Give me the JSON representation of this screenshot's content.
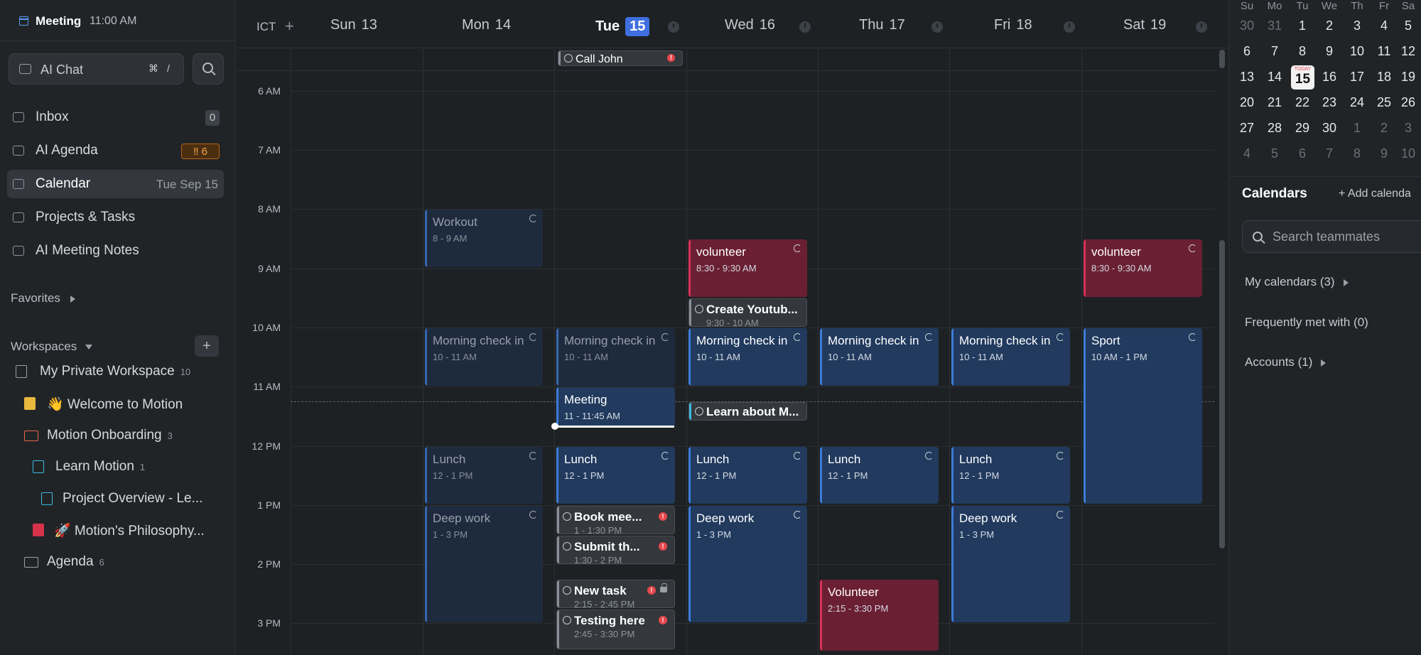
{
  "topbar": {
    "title": "Meeting",
    "time": "11:00 AM",
    "icon": "calendar-icon"
  },
  "search": {
    "ai_chat_label": "AI Chat",
    "shortcut_key": "⌘",
    "shortcut_slash": "/"
  },
  "nav": [
    {
      "label": "Inbox",
      "badge": "0",
      "icon": "inbox-icon"
    },
    {
      "label": "AI Agenda",
      "badge": "‼ 6",
      "icon": "agenda-icon"
    },
    {
      "label": "Calendar",
      "date": "Tue Sep 15",
      "icon": "calendar-icon",
      "active": true
    },
    {
      "label": "Projects & Tasks",
      "icon": "cube-icon"
    },
    {
      "label": "AI Meeting Notes",
      "icon": "notes-icon"
    }
  ],
  "favorites_label": "Favorites",
  "workspaces_label": "Workspaces",
  "tree": [
    {
      "label": "My Private Workspace",
      "count": "10"
    },
    {
      "label": "👋 Welcome to Motion"
    },
    {
      "label": "Motion Onboarding",
      "count": "3"
    },
    {
      "label": "Learn Motion",
      "count": "1"
    },
    {
      "label": "Project Overview - Le..."
    },
    {
      "label": "🚀 Motion's Philosophy..."
    },
    {
      "label": "Agenda",
      "count": "6"
    }
  ],
  "calendar": {
    "timezone": "ICT",
    "days": [
      {
        "name": "Sun",
        "num": "13"
      },
      {
        "name": "Mon",
        "num": "14"
      },
      {
        "name": "Tue",
        "num": "15",
        "today": true
      },
      {
        "name": "Wed",
        "num": "16"
      },
      {
        "name": "Thu",
        "num": "17"
      },
      {
        "name": "Fri",
        "num": "18"
      },
      {
        "name": "Sat",
        "num": "19"
      }
    ],
    "hours": [
      "6 AM",
      "7 AM",
      "8 AM",
      "9 AM",
      "10 AM",
      "11 AM",
      "12 PM",
      "1 PM",
      "2 PM",
      "3 PM"
    ],
    "allday": {
      "title": "Call John"
    },
    "events": {
      "mon_workout": {
        "title": "Workout",
        "time": "8 - 9 AM"
      },
      "mon_checkin": {
        "title": "Morning check in",
        "time": "10 - 11 AM"
      },
      "mon_lunch": {
        "title": "Lunch",
        "time": "12 - 1 PM"
      },
      "mon_deep": {
        "title": "Deep work",
        "time": "1 - 3 PM"
      },
      "tue_checkin": {
        "title": "Morning check in",
        "time": "10 - 11 AM"
      },
      "tue_meeting": {
        "title": "Meeting",
        "time": "11 - 11:45 AM"
      },
      "tue_lunch": {
        "title": "Lunch",
        "time": "12 - 1 PM"
      },
      "tue_book": {
        "title": "Book mee...",
        "time": "1 - 1:30 PM"
      },
      "tue_submit": {
        "title": "Submit th...",
        "time": "1:30 - 2 PM"
      },
      "tue_newtask": {
        "title": "New task",
        "time": "2:15 - 2:45 PM"
      },
      "tue_testing": {
        "title": "Testing here",
        "time": "2:45 - 3:30 PM"
      },
      "wed_volunteer": {
        "title": "volunteer",
        "time": "8:30 - 9:30 AM"
      },
      "wed_youtube": {
        "title": "Create Youtub...",
        "time": "9:30 - 10 AM"
      },
      "wed_checkin": {
        "title": "Morning check in",
        "time": "10 - 11 AM"
      },
      "wed_learn": {
        "title": "Learn about M..."
      },
      "wed_lunch": {
        "title": "Lunch",
        "time": "12 - 1 PM"
      },
      "wed_deep": {
        "title": "Deep work",
        "time": "1 - 3 PM"
      },
      "thu_checkin": {
        "title": "Morning check in",
        "time": "10 - 11 AM"
      },
      "thu_lunch": {
        "title": "Lunch",
        "time": "12 - 1 PM"
      },
      "thu_volunteer": {
        "title": "Volunteer",
        "time": "2:15 - 3:30 PM"
      },
      "fri_checkin": {
        "title": "Morning check in",
        "time": "10 - 11 AM"
      },
      "fri_lunch": {
        "title": "Lunch",
        "time": "12 - 1 PM"
      },
      "fri_deep": {
        "title": "Deep work",
        "time": "1 - 3 PM"
      },
      "sat_volunteer": {
        "title": "volunteer",
        "time": "8:30 - 9:30 AM"
      },
      "sat_sport": {
        "title": "Sport",
        "time": "10 AM - 1 PM"
      }
    }
  },
  "mini_calendar": {
    "weekdays": [
      "Su",
      "Mo",
      "Tu",
      "We",
      "Th",
      "Fr",
      "Sa"
    ],
    "weeks": [
      [
        "30",
        "31",
        "1",
        "2",
        "3",
        "4",
        "5"
      ],
      [
        "6",
        "7",
        "8",
        "9",
        "10",
        "11",
        "12"
      ],
      [
        "13",
        "14",
        "15",
        "16",
        "17",
        "18",
        "19"
      ],
      [
        "20",
        "21",
        "22",
        "23",
        "24",
        "25",
        "26"
      ],
      [
        "27",
        "28",
        "29",
        "30",
        "1",
        "2",
        "3"
      ],
      [
        "4",
        "5",
        "6",
        "7",
        "8",
        "9",
        "10"
      ]
    ],
    "today_month": "TODAY"
  },
  "calendars_panel": {
    "title": "Calendars",
    "add_label": "+ Add calenda",
    "search_placeholder": "Search teammates",
    "my_calendars": "My calendars (3)",
    "frequently_met": "Frequently met with (0)",
    "accounts": "Accounts (1)"
  },
  "colors": {
    "accent": "#3f6fe0",
    "event_blue": "#213a5e",
    "event_red": "#6b1f33",
    "alert": "#e5484d"
  }
}
